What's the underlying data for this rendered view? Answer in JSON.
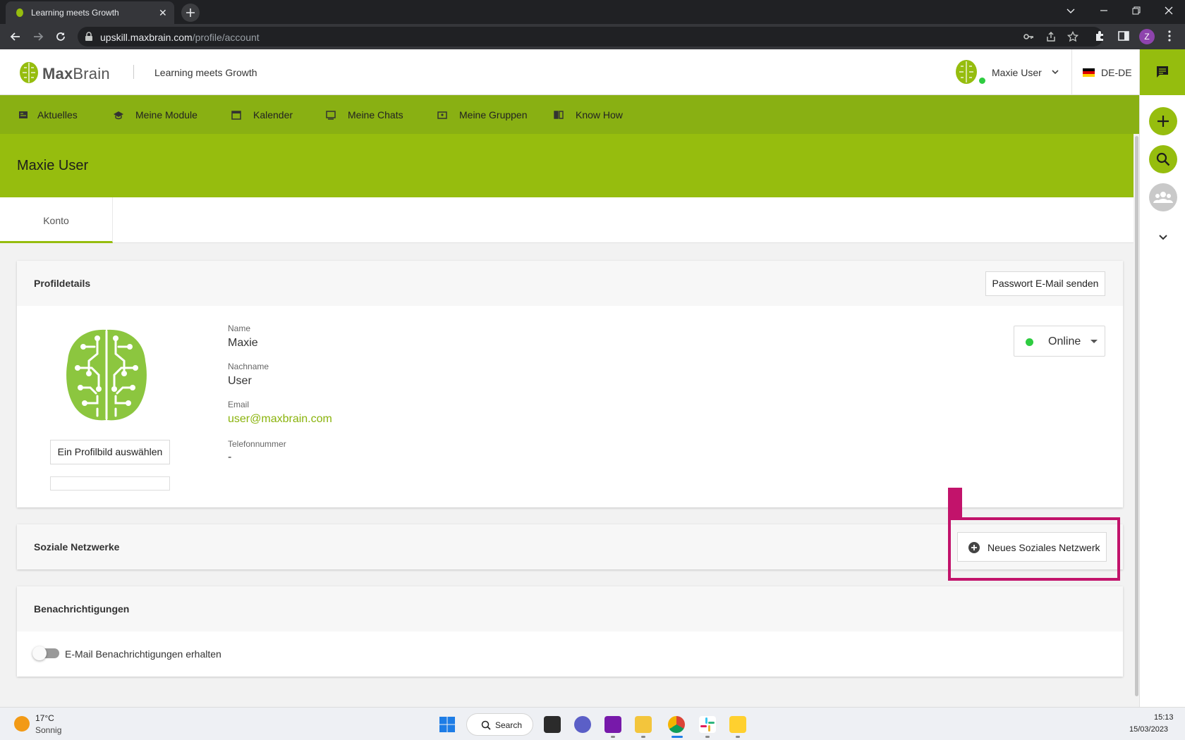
{
  "browser": {
    "tab_title": "Learning meets Growth",
    "tab_close": "✕",
    "url_host": "upskill.maxbrain.com",
    "url_path": "/profile/account",
    "profile_initial": "Z"
  },
  "header": {
    "logo_bold": "Max",
    "logo_light": "Brain",
    "tagline": "Learning meets Growth",
    "user_name": "Maxie User",
    "language": "DE-DE"
  },
  "nav": {
    "items": [
      {
        "label": "Aktuelles",
        "icon": "newspaper-icon"
      },
      {
        "label": "Meine Module",
        "icon": "graduation-cap-icon"
      },
      {
        "label": "Kalender",
        "icon": "calendar-icon"
      },
      {
        "label": "Meine Chats",
        "icon": "chat-icon"
      },
      {
        "label": "Meine Gruppen",
        "icon": "groups-icon"
      },
      {
        "label": "Know How",
        "icon": "book-icon"
      }
    ]
  },
  "page": {
    "title": "Maxie User",
    "tabs": [
      {
        "label": "Konto",
        "active": true
      }
    ]
  },
  "profile_card": {
    "title": "Profildetails",
    "password_button": "Passwort E-Mail senden",
    "choose_picture_button": "Ein Profilbild auswählen",
    "fields": {
      "name_label": "Name",
      "name_value": "Maxie",
      "lastname_label": "Nachname",
      "lastname_value": "User",
      "email_label": "Email",
      "email_value": "user@maxbrain.com",
      "phone_label": "Telefonnummer",
      "phone_value": "-"
    },
    "status": "Online"
  },
  "social_card": {
    "title": "Soziale Netzwerke",
    "add_button": "Neues Soziales Netzwerk"
  },
  "notifications_card": {
    "title": "Benachrichtigungen",
    "email_toggle_label": "E-Mail Benachrichtigungen erhalten",
    "email_toggle_on": false
  },
  "taskbar": {
    "weather_temp": "17°C",
    "weather_desc": "Sonnig",
    "search_label": "Search",
    "time": "15:13",
    "date": "15/03/2023"
  },
  "colors": {
    "brand_green": "#96bd0e",
    "nav_green": "#89b013",
    "highlight": "#c2136b",
    "online": "#2ecc40"
  }
}
